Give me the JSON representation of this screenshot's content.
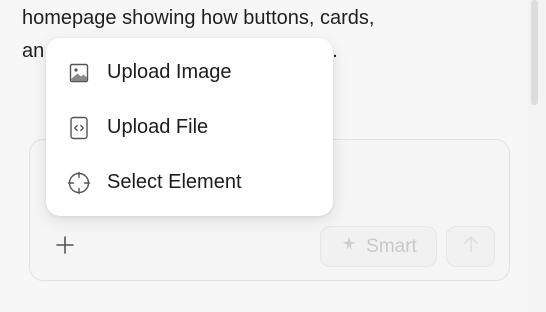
{
  "message": {
    "line1": "homepage showing how buttons, cards,",
    "line2_start": "an",
    "line2_end": "."
  },
  "menu": {
    "items": [
      {
        "label": "Upload Image",
        "icon": "image-icon"
      },
      {
        "label": "Upload File",
        "icon": "code-file-icon"
      },
      {
        "label": "Select Element",
        "icon": "crosshair-icon"
      }
    ]
  },
  "composer": {
    "add_icon": "plus-icon",
    "smart_label": "Smart",
    "smart_icon": "sparkle-icon",
    "send_icon": "arrow-up-icon"
  }
}
